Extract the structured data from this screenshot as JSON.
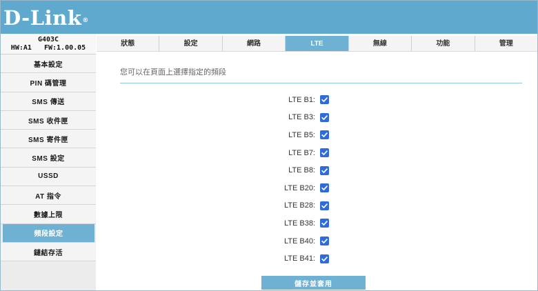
{
  "brand": {
    "name": "D-Link",
    "mark": "®"
  },
  "device": {
    "model": "G403C",
    "hw": "HW:A1",
    "fw": "FW:1.00.05"
  },
  "sidebar": {
    "items": [
      {
        "label": "基本設定",
        "active": false
      },
      {
        "label": "PIN 碼管理",
        "active": false
      },
      {
        "label": "SMS 傳送",
        "active": false
      },
      {
        "label": "SMS 收件匣",
        "active": false
      },
      {
        "label": "SMS 寄件匣",
        "active": false
      },
      {
        "label": "SMS 設定",
        "active": false
      },
      {
        "label": "USSD",
        "active": false
      },
      {
        "label": "AT 指令",
        "active": false
      },
      {
        "label": "數據上限",
        "active": false
      },
      {
        "label": "頻段設定",
        "active": true
      },
      {
        "label": "鏈結存活",
        "active": false
      }
    ]
  },
  "tabs": [
    {
      "label": "狀態",
      "active": false
    },
    {
      "label": "設定",
      "active": false
    },
    {
      "label": "網路",
      "active": false
    },
    {
      "label": "LTE",
      "active": true
    },
    {
      "label": "無線",
      "active": false
    },
    {
      "label": "功能",
      "active": false
    },
    {
      "label": "管理",
      "active": false
    }
  ],
  "content": {
    "intro": "您可以在頁面上選擇指定的頻段",
    "bands": [
      {
        "label": "LTE B1:",
        "checked": true
      },
      {
        "label": "LTE B3:",
        "checked": true
      },
      {
        "label": "LTE B5:",
        "checked": true
      },
      {
        "label": "LTE B7:",
        "checked": true
      },
      {
        "label": "LTE B8:",
        "checked": true
      },
      {
        "label": "LTE B20:",
        "checked": true
      },
      {
        "label": "LTE B28:",
        "checked": true
      },
      {
        "label": "LTE B38:",
        "checked": true
      },
      {
        "label": "LTE B40:",
        "checked": true
      },
      {
        "label": "LTE B41:",
        "checked": true
      }
    ],
    "save_label": "儲存並套用"
  },
  "colors": {
    "header": "#5fa9cf",
    "accent": "#6fb1d2",
    "checkbox": "#2f6bd9",
    "divider": "#8fc6dc"
  }
}
